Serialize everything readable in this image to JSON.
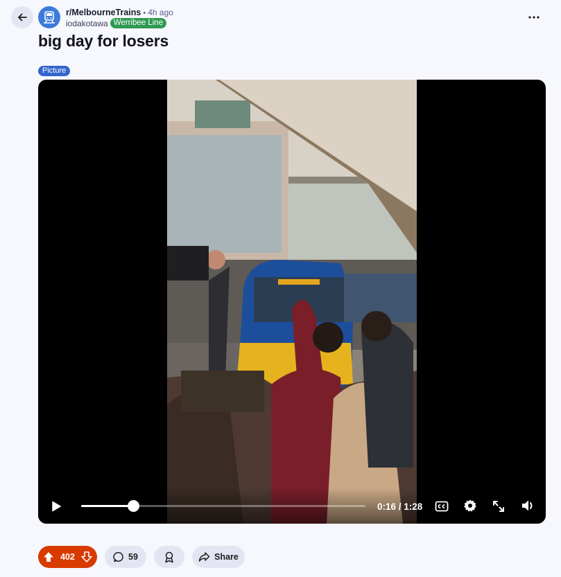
{
  "header": {
    "subreddit": "r/MelbourneTrains",
    "separator": "•",
    "age": "4h ago",
    "username": "iodakotawa",
    "user_flair": "Werribee Line"
  },
  "post": {
    "title": "big day for losers",
    "flair": "Picture"
  },
  "video": {
    "progress": 0.182,
    "time": "0:16 / 1:28"
  },
  "actions": {
    "upvotes": "402",
    "comments": "59",
    "share_label": "Share"
  },
  "colors": {
    "upvote_active": "#d93a00",
    "user_flair_bg": "#2f9a52",
    "post_flair_bg": "#3366cc",
    "pill_bg": "#e3e6f2"
  }
}
